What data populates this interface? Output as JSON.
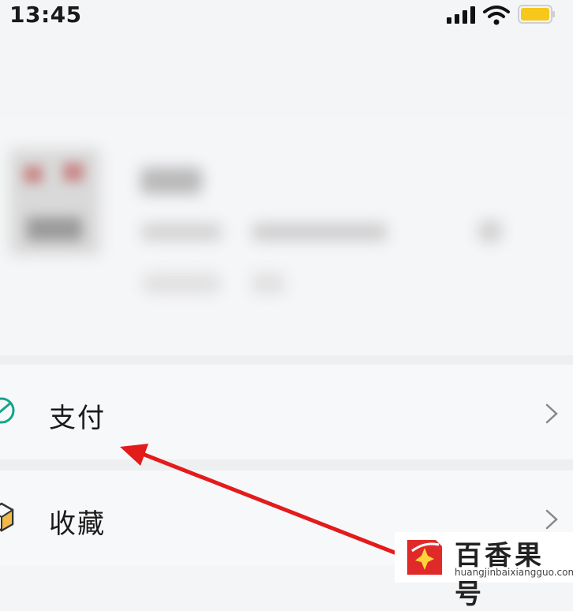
{
  "status_bar": {
    "time": "13:45",
    "battery_color": "#f7c71c"
  },
  "menu": {
    "items": [
      {
        "label": "支付",
        "icon": "payment-icon",
        "icon_color": "#12a58a"
      },
      {
        "label": "收藏",
        "icon": "favorites-cube-icon",
        "icon_color": "#e2a53a"
      }
    ]
  },
  "annotation": {
    "arrow_color": "#e31b1b",
    "points_to": "支付"
  },
  "watermark": {
    "title": "百香果号",
    "url": "huangjinbaixiangguo.com"
  }
}
